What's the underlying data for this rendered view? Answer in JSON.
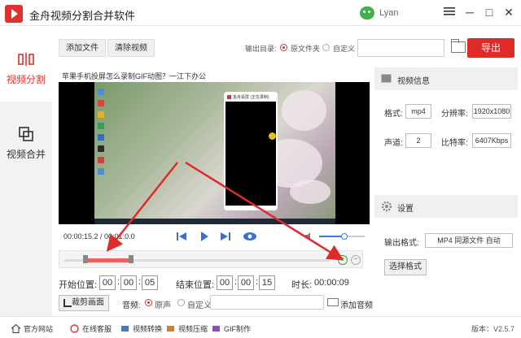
{
  "app": {
    "title": "金舟视频分割合并软件",
    "user_name": "Lyan",
    "colors": {
      "accent": "#e02a2a",
      "selection": "#f06060"
    }
  },
  "window_controls": {
    "menu_icon": "menu-icon",
    "minimize": "─",
    "maximize": "□",
    "close": "✕"
  },
  "sidebar": {
    "items": [
      {
        "label": "视频分割",
        "icon": "split-icon",
        "active": true
      },
      {
        "label": "视频合并",
        "icon": "merge-icon",
        "active": false
      }
    ]
  },
  "toolbar": {
    "add_file": "添加文件",
    "clear_video": "清除视频",
    "output_label": "输出目录:",
    "option_source": "原文件夹",
    "option_custom": "自定义",
    "path_value": "",
    "export": "导出"
  },
  "video": {
    "title": "苹果手机投屏怎么录制GIF动图？一江下办公",
    "phone_app_title": "金舟投屏 (正在录制)",
    "time_display": "00:00:15.2 / 00:01:0.0"
  },
  "trim": {
    "start_label": "开始位置:",
    "start": [
      "00",
      "00",
      "05"
    ],
    "end_label": "结束位置:",
    "end": [
      "00",
      "00",
      "15"
    ],
    "duration_label": "时长:",
    "duration": "00:00:09"
  },
  "audio": {
    "crop_label": "裁剪画面",
    "label": "音频:",
    "option_original": "原声",
    "option_custom": "自定义",
    "add_audio": "添加音频"
  },
  "info": {
    "header": "视频信息",
    "format_label": "格式:",
    "format": "mp4",
    "resolution_label": "分辨率:",
    "resolution": "1920x1080",
    "channel_label": "声道:",
    "channel": "2",
    "bitrate_label": "比特率:",
    "bitrate": "6407Kbps"
  },
  "settings": {
    "header": "设置",
    "output_format_label": "输出格式:",
    "output_format": "MP4 同源文件 自动",
    "choose_format": "选择格式"
  },
  "statusbar": {
    "website": "官方网站",
    "support": "在线客服",
    "convert": "视频转换",
    "compress": "视频压缩",
    "gif": "GIF制作",
    "version": "版本：V2.5.7"
  },
  "playback": {
    "position": 0.25,
    "volume": 0.55,
    "selection_start": 0.08,
    "selection_end": 0.25
  }
}
